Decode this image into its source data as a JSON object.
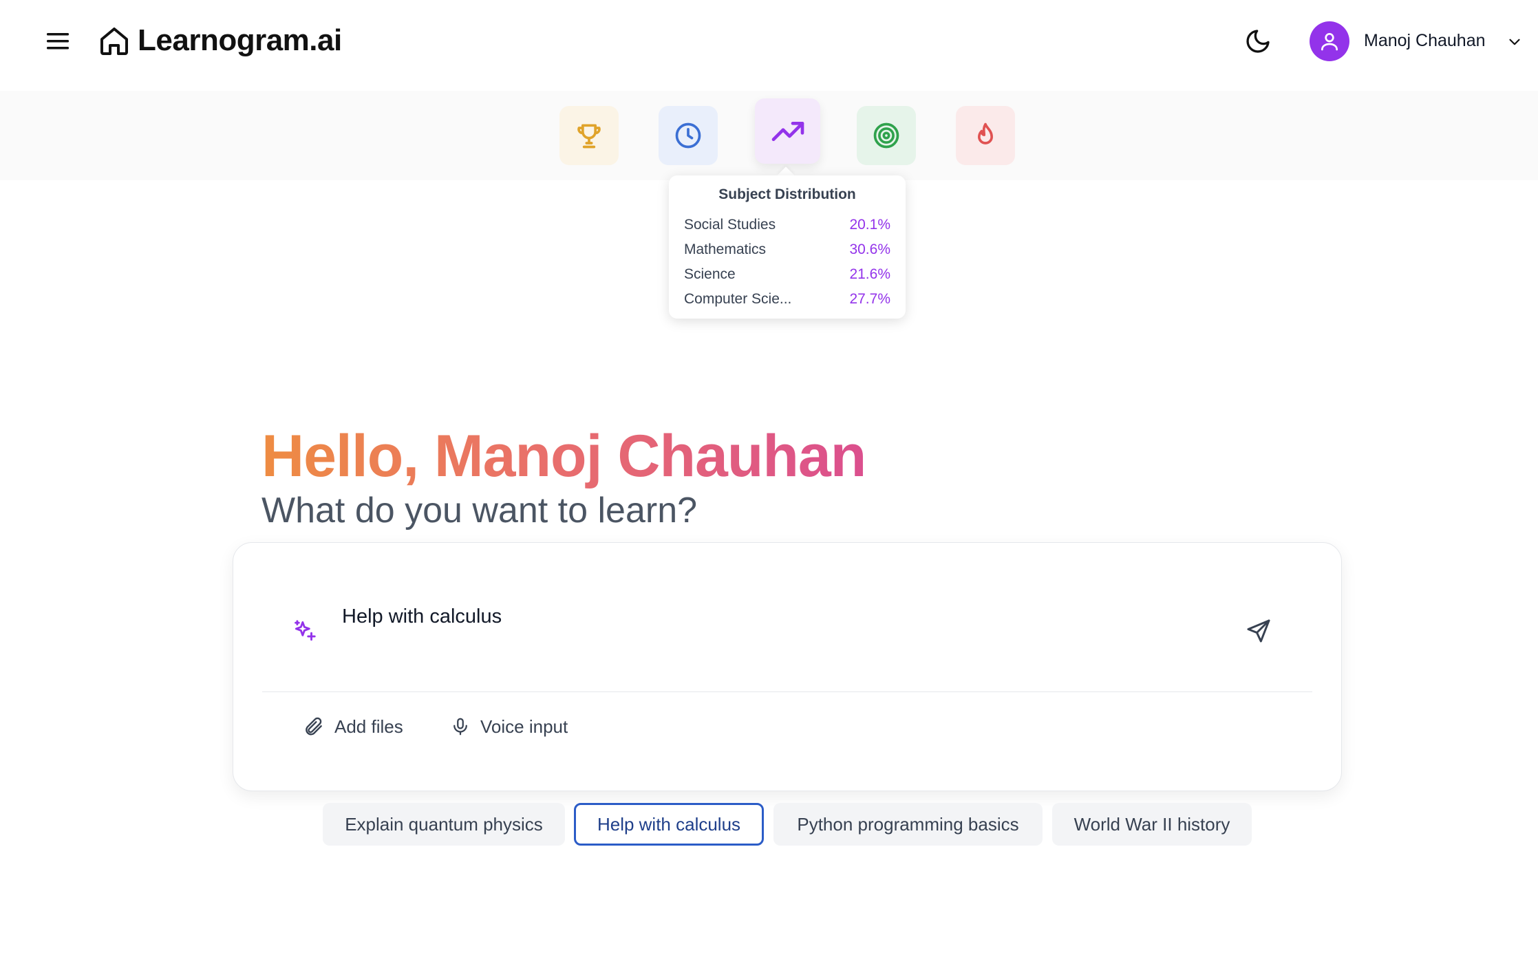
{
  "header": {
    "brand": "Learnogram.ai",
    "user_name": "Manoj Chauhan",
    "icons": [
      "menu-icon",
      "home-icon",
      "moon-icon",
      "user-icon",
      "chevron-down-icon"
    ]
  },
  "stats": {
    "icons": [
      "trophy-icon",
      "clock-icon",
      "trending-up-icon",
      "target-icon",
      "flame-icon"
    ],
    "colors": {
      "trophy": "#e0a32a",
      "clock": "#3b6fd4",
      "trend": "#9333ea",
      "target": "#2fa24c",
      "flame": "#e05252"
    }
  },
  "tooltip": {
    "title": "Subject Distribution",
    "rows": [
      {
        "label": "Social Studies",
        "value": "20.1%"
      },
      {
        "label": "Mathematics",
        "value": "30.6%"
      },
      {
        "label": "Science",
        "value": "21.6%"
      },
      {
        "label": "Computer Scie...",
        "value": "27.7%"
      }
    ]
  },
  "hero": {
    "greeting": "Hello, Manoj Chauhan",
    "subtitle": "What do you want to learn?"
  },
  "composer": {
    "value": "Help with calculus",
    "add_files": "Add files",
    "voice_input": "Voice input",
    "icons": [
      "sparkles-icon",
      "send-icon",
      "paperclip-icon",
      "microphone-icon"
    ]
  },
  "suggestions": [
    {
      "label": "Explain quantum physics"
    },
    {
      "label": "Help with calculus",
      "selected": true
    },
    {
      "label": "Python programming basics"
    },
    {
      "label": "World War II history"
    }
  ],
  "colors": {
    "accent": "#9333ea",
    "selected_chip_border": "#2b5cc7"
  }
}
